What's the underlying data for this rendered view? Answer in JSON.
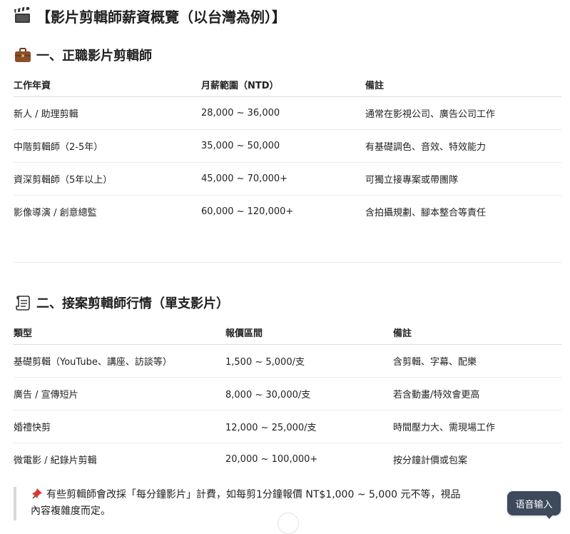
{
  "title": "【影片剪輯師薪資概覽（以台灣為例）】",
  "title_icon": "clapperboard-icon",
  "section1": {
    "heading": "一、正職影片剪輯師",
    "icon": "briefcase-icon",
    "columns": [
      "工作年資",
      "月薪範圍（NTD）",
      "備註"
    ],
    "rows": [
      [
        "新人 / 助理剪輯",
        "28,000 ~ 36,000",
        "通常在影視公司、廣告公司工作"
      ],
      [
        "中階剪輯師（2-5年）",
        "35,000 ~ 50,000",
        "有基礎調色、音效、特效能力"
      ],
      [
        "資深剪輯師（5年以上）",
        "45,000 ~ 70,000+",
        "可獨立接專案或帶團隊"
      ],
      [
        "影像導演 / 創意總監",
        "60,000 ~ 120,000+",
        "含拍攝規劃、腳本整合等責任"
      ]
    ]
  },
  "section2": {
    "heading": "二、接案剪輯師行情（單支影片）",
    "icon": "scroll-icon",
    "columns": [
      "類型",
      "報價區間",
      "備註"
    ],
    "rows": [
      [
        "基礎剪輯（YouTube、講座、訪談等）",
        "1,500 ~ 5,000/支",
        "含剪輯、字幕、配樂"
      ],
      [
        "廣告 / 宣傳短片",
        "8,000 ~ 30,000/支",
        "若含動畫/特效會更高"
      ],
      [
        "婚禮快剪",
        "12,000 ~ 25,000/支",
        "時間壓力大、需現場工作"
      ],
      [
        "微電影 / 紀錄片剪輯",
        "20,000 ~ 100,000+",
        "按分鐘計價或包案"
      ]
    ]
  },
  "note": {
    "icon": "pushpin-icon",
    "line1": "有些剪輯師會改採「每分鐘影片」計費，如每剪1分鐘報價 NT$1,000 ~ 5,000 元不等，視品",
    "line2": "內容複雜度而定。"
  },
  "voice_button": "语音输入"
}
